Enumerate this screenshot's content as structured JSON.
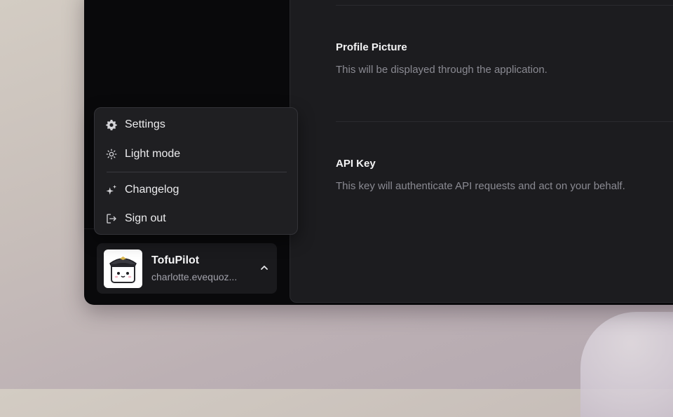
{
  "profile_picture": {
    "title": "Profile Picture",
    "description": "This will be displayed through the application."
  },
  "api_key": {
    "title": "API Key",
    "description": "This key will authenticate API requests and act on your behalf."
  },
  "menu": {
    "items": [
      {
        "label": "Settings",
        "icon": "gear-icon"
      },
      {
        "label": "Light mode",
        "icon": "sun-icon"
      },
      {
        "label": "Changelog",
        "icon": "sparkles-icon"
      },
      {
        "label": "Sign out",
        "icon": "sign-out-icon"
      }
    ]
  },
  "user": {
    "name": "TofuPilot",
    "email": "charlotte.evequoz...",
    "avatar": "tofu-pilot-mascot"
  },
  "colors": {
    "sidebar_bg": "#09090b",
    "panel_bg": "#1c1c1f",
    "menu_bg": "#1f1f22",
    "text_primary": "#f4f4f5",
    "text_muted": "#8a8a92"
  }
}
